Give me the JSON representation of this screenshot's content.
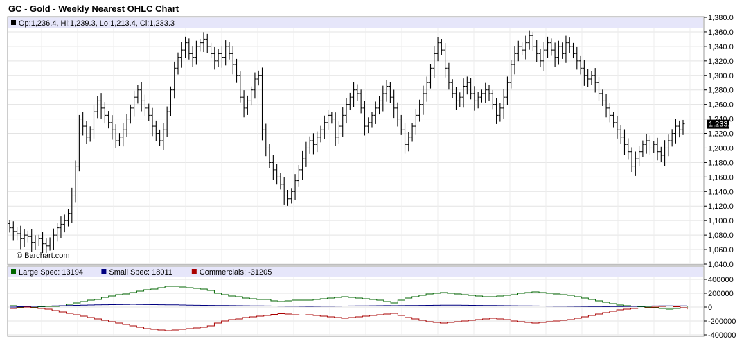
{
  "title": "GC - Gold - Weekly Nearest OHLC Chart",
  "watermark": "© Barchart.com",
  "chart_data": [
    {
      "type": "ohlc",
      "legend": "Op:1,236.4, Hi:1,239.3, Lo:1,213.4, Cl:1,233.3",
      "last_price_label": "1,233.3",
      "last_price": 1233.3,
      "ylim": [
        1040,
        1380
      ],
      "yticks": [
        1040,
        1060,
        1080,
        1100,
        1120,
        1140,
        1160,
        1180,
        1200,
        1220,
        1240,
        1260,
        1280,
        1300,
        1320,
        1340,
        1360,
        1380
      ],
      "ytick_labels": [
        "1,040.0",
        "1,060.0",
        "1,080.0",
        "1,100.0",
        "1,120.0",
        "1,140.0",
        "1,160.0",
        "1,180.0",
        "1,200.0",
        "1,220.0",
        "1,240.0",
        "1,260.0",
        "1,280.0",
        "1,300.0",
        "1,320.0",
        "1,340.0",
        "1,360.0",
        "1,380.0"
      ],
      "grid": true,
      "closes": [
        1090,
        1085,
        1082,
        1075,
        1080,
        1078,
        1070,
        1072,
        1075,
        1068,
        1065,
        1072,
        1080,
        1090,
        1095,
        1100,
        1110,
        1135,
        1175,
        1240,
        1230,
        1215,
        1225,
        1250,
        1265,
        1255,
        1245,
        1235,
        1225,
        1210,
        1215,
        1225,
        1240,
        1255,
        1270,
        1280,
        1265,
        1255,
        1245,
        1230,
        1220,
        1210,
        1225,
        1250,
        1280,
        1310,
        1325,
        1335,
        1345,
        1330,
        1325,
        1340,
        1345,
        1350,
        1340,
        1330,
        1320,
        1330,
        1325,
        1340,
        1330,
        1315,
        1300,
        1270,
        1255,
        1265,
        1280,
        1295,
        1300,
        1225,
        1200,
        1180,
        1170,
        1160,
        1150,
        1135,
        1130,
        1140,
        1155,
        1170,
        1185,
        1200,
        1210,
        1205,
        1215,
        1225,
        1235,
        1245,
        1240,
        1215,
        1230,
        1245,
        1260,
        1270,
        1280,
        1275,
        1255,
        1230,
        1235,
        1245,
        1255,
        1265,
        1275,
        1285,
        1270,
        1255,
        1240,
        1225,
        1205,
        1215,
        1230,
        1245,
        1260,
        1275,
        1290,
        1310,
        1330,
        1345,
        1335,
        1310,
        1290,
        1275,
        1265,
        1270,
        1285,
        1290,
        1275,
        1265,
        1270,
        1275,
        1280,
        1275,
        1260,
        1245,
        1255,
        1270,
        1290,
        1315,
        1330,
        1340,
        1335,
        1345,
        1355,
        1340,
        1330,
        1320,
        1335,
        1345,
        1335,
        1325,
        1340,
        1330,
        1345,
        1340,
        1330,
        1320,
        1310,
        1300,
        1295,
        1300,
        1290,
        1275,
        1265,
        1255,
        1245,
        1235,
        1225,
        1215,
        1205,
        1195,
        1175,
        1185,
        1195,
        1205,
        1210,
        1200,
        1205,
        1195,
        1190,
        1200,
        1210,
        1220,
        1230,
        1225,
        1233.3
      ]
    },
    {
      "type": "line",
      "legend_items": [
        {
          "name": "Large Spec: 13194",
          "color": "#006600"
        },
        {
          "name": "Small Spec: 18011",
          "color": "#000080"
        },
        {
          "name": "Commercials: -31205",
          "color": "#aa0000"
        }
      ],
      "ylim": [
        -400000,
        400000
      ],
      "yticks": [
        400000,
        200000,
        0,
        -200000,
        -400000
      ],
      "ytick_labels": [
        "400000",
        "200000",
        "0",
        "-200000",
        "-400000"
      ],
      "series": [
        {
          "name": "Large Spec: 13194",
          "color": "#006600",
          "values": [
            20000,
            0,
            -15000,
            -5000,
            5000,
            10000,
            10000,
            20000,
            40000,
            60000,
            80000,
            100000,
            110000,
            140000,
            160000,
            180000,
            190000,
            210000,
            230000,
            250000,
            260000,
            280000,
            300000,
            300000,
            290000,
            280000,
            270000,
            260000,
            240000,
            200000,
            180000,
            160000,
            150000,
            130000,
            120000,
            110000,
            110000,
            90000,
            80000,
            90000,
            100000,
            100000,
            100000,
            110000,
            120000,
            130000,
            140000,
            150000,
            140000,
            130000,
            120000,
            110000,
            100000,
            80000,
            60000,
            100000,
            130000,
            150000,
            170000,
            190000,
            200000,
            210000,
            200000,
            190000,
            180000,
            170000,
            160000,
            150000,
            150000,
            160000,
            170000,
            180000,
            200000,
            210000,
            220000,
            210000,
            200000,
            190000,
            180000,
            170000,
            150000,
            130000,
            110000,
            90000,
            70000,
            50000,
            30000,
            20000,
            10000,
            5000,
            0,
            -10000,
            -20000,
            -30000,
            -20000,
            -10000,
            13194
          ]
        },
        {
          "name": "Small Spec: 18011",
          "color": "#000080",
          "values": [
            0,
            5000,
            8000,
            10000,
            12000,
            15000,
            18000,
            20000,
            22000,
            25000,
            28000,
            30000,
            32000,
            34000,
            35000,
            36000,
            38000,
            40000,
            38000,
            36000,
            35000,
            34000,
            33000,
            32000,
            30000,
            28000,
            26000,
            25000,
            24000,
            23000,
            22000,
            21000,
            20000,
            19000,
            18000,
            17000,
            16000,
            15000,
            14000,
            13000,
            12000,
            11000,
            10000,
            11000,
            12000,
            13000,
            14000,
            15000,
            16000,
            17000,
            18000,
            19000,
            20000,
            21000,
            20000,
            21000,
            22000,
            23000,
            24000,
            25000,
            26000,
            27000,
            28000,
            27000,
            26000,
            25000,
            24000,
            23000,
            22000,
            21000,
            20000,
            19000,
            18000,
            17000,
            16000,
            15000,
            14000,
            13000,
            12000,
            11000,
            10000,
            9000,
            8000,
            7000,
            6000,
            7000,
            8000,
            9000,
            10000,
            12000,
            14000,
            16000,
            18000,
            17000,
            16000,
            17000,
            18011
          ]
        },
        {
          "name": "Commercials: -31205",
          "color": "#aa0000",
          "values": [
            -20000,
            -10000,
            0,
            -10000,
            -20000,
            -30000,
            -50000,
            -70000,
            -90000,
            -110000,
            -130000,
            -150000,
            -170000,
            -190000,
            -210000,
            -230000,
            -250000,
            -270000,
            -290000,
            -310000,
            -320000,
            -330000,
            -340000,
            -330000,
            -320000,
            -310000,
            -300000,
            -290000,
            -270000,
            -230000,
            -200000,
            -180000,
            -170000,
            -150000,
            -140000,
            -130000,
            -120000,
            -105000,
            -95000,
            -100000,
            -110000,
            -115000,
            -110000,
            -120000,
            -130000,
            -140000,
            -150000,
            -160000,
            -150000,
            -140000,
            -130000,
            -120000,
            -110000,
            -100000,
            -90000,
            -120000,
            -150000,
            -170000,
            -190000,
            -210000,
            -220000,
            -230000,
            -220000,
            -210000,
            -200000,
            -190000,
            -180000,
            -170000,
            -160000,
            -170000,
            -180000,
            -200000,
            -210000,
            -220000,
            -230000,
            -220000,
            -210000,
            -200000,
            -190000,
            -180000,
            -160000,
            -140000,
            -120000,
            -100000,
            -80000,
            -60000,
            -40000,
            -30000,
            -20000,
            -15000,
            -10000,
            0,
            10000,
            15000,
            5000,
            -10000,
            -31205
          ]
        }
      ]
    }
  ]
}
